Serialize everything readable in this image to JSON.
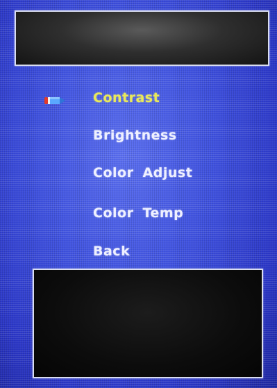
{
  "osd_menu": {
    "items": [
      {
        "label": "Contrast",
        "selected": true
      },
      {
        "label": "Brightness",
        "selected": false
      },
      {
        "label": "Color  Adjust",
        "selected": false
      },
      {
        "label": "Color  Temp",
        "selected": false
      },
      {
        "label": "Back",
        "selected": false
      }
    ],
    "selection_icon": "pencil-cursor-icon"
  },
  "colors": {
    "background": "#3f52e0",
    "text": "#eef0ff",
    "selected_text": "#e8e85a",
    "panel_border": "#d9ddf0"
  }
}
